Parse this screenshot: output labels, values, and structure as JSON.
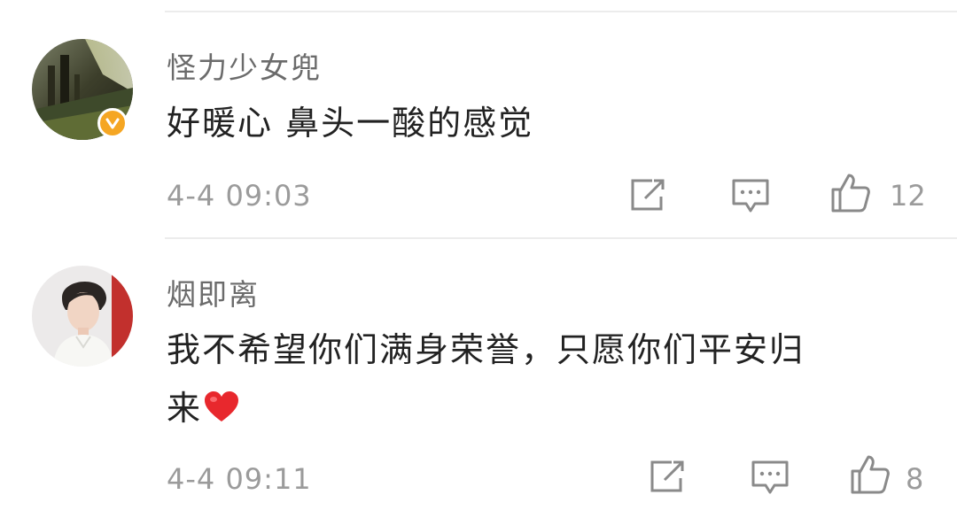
{
  "comments": [
    {
      "username": "怪力少女兜",
      "text": "好暖心 鼻头一酸的感觉",
      "time": "4-4 09:03",
      "likes": "12",
      "verified": true
    },
    {
      "username": "烟即离",
      "text_line1": "我不希望你们满身荣誉，只愿你们平安归",
      "text_line2": "来",
      "time": "4-4 09:11",
      "likes": "8",
      "emoji": "red-heart"
    }
  ],
  "colors": {
    "badge": "#f5a623",
    "heart": "#e8282d"
  },
  "icons": [
    "share-icon",
    "comment-icon",
    "like-icon",
    "verified-badge-icon"
  ]
}
